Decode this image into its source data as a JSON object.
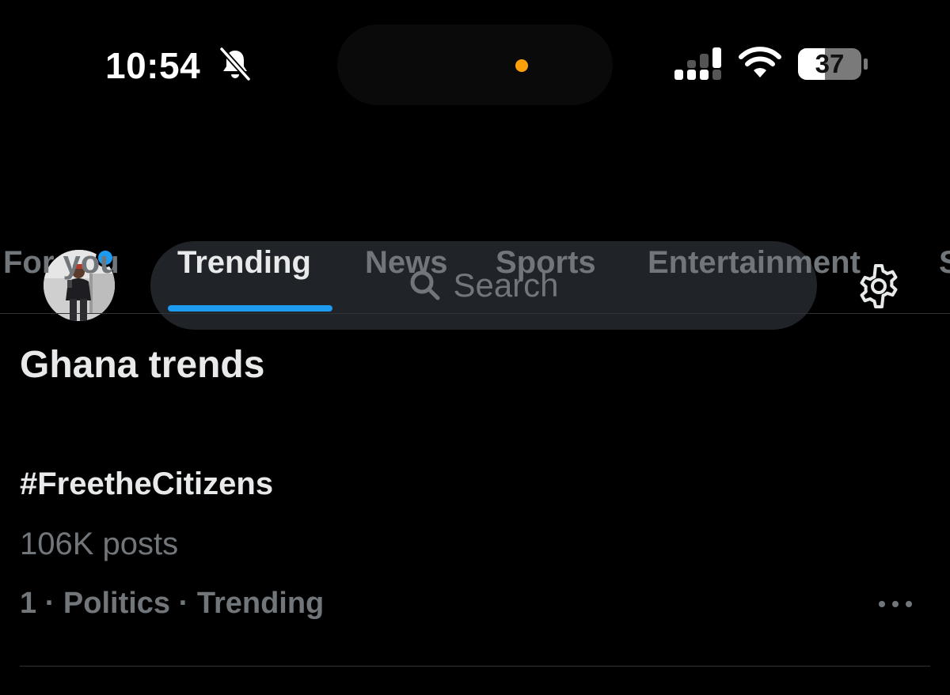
{
  "status_bar": {
    "time": "10:54",
    "battery_level": "37",
    "icons": [
      "bell-slash-icon",
      "cellular-signal-icon",
      "wifi-icon",
      "battery-icon"
    ]
  },
  "header": {
    "search_placeholder": "Search",
    "icons": [
      "search-icon",
      "gear-icon"
    ]
  },
  "tabs": [
    {
      "label": "For you",
      "active": false
    },
    {
      "label": "Trending",
      "active": true
    },
    {
      "label": "News",
      "active": false
    },
    {
      "label": "Sports",
      "active": false
    },
    {
      "label": "Entertainment",
      "active": false
    },
    {
      "label": "S",
      "active": false
    }
  ],
  "section": {
    "title": "Ghana trends"
  },
  "trends": [
    {
      "name": "#FreetheCitizens",
      "posts": "106K posts",
      "context": "1 · Politics · Trending"
    }
  ],
  "colors": {
    "background": "#000000",
    "accent": "#1d9bf0",
    "text_primary": "#e7e9ea",
    "text_secondary": "#71767b",
    "search_bg": "#202327",
    "notification_dot": "#ff9f0a"
  }
}
